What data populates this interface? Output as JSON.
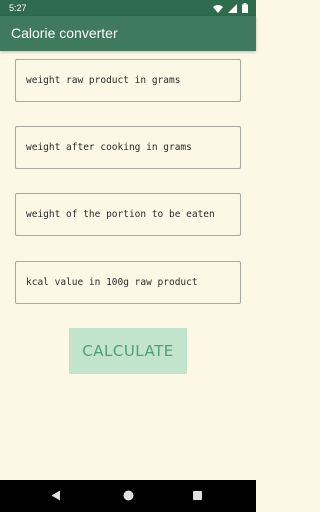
{
  "status_bar": {
    "time": "5:27"
  },
  "app_bar": {
    "title": "Calorie converter"
  },
  "form": {
    "fields": [
      {
        "placeholder": "weight raw product in grams",
        "value": ""
      },
      {
        "placeholder": "weight after cooking in grams",
        "value": ""
      },
      {
        "placeholder": "weight of the portion to be eaten",
        "value": ""
      },
      {
        "placeholder": "kcal value in 100g raw product",
        "value": ""
      }
    ],
    "calculate_label": "CALCULATE"
  },
  "icons": {
    "status": [
      "wifi-icon",
      "signal-icon",
      "battery-icon"
    ],
    "nav": [
      "back-icon",
      "home-icon",
      "recents-icon"
    ]
  },
  "colors": {
    "status_bar": "#2e6b4f",
    "app_bar": "#3f7a5f",
    "background": "#fdf8e6",
    "button_bg": "#c2e4cd",
    "button_text": "#4f9e7c",
    "nav_bar": "#000000"
  }
}
